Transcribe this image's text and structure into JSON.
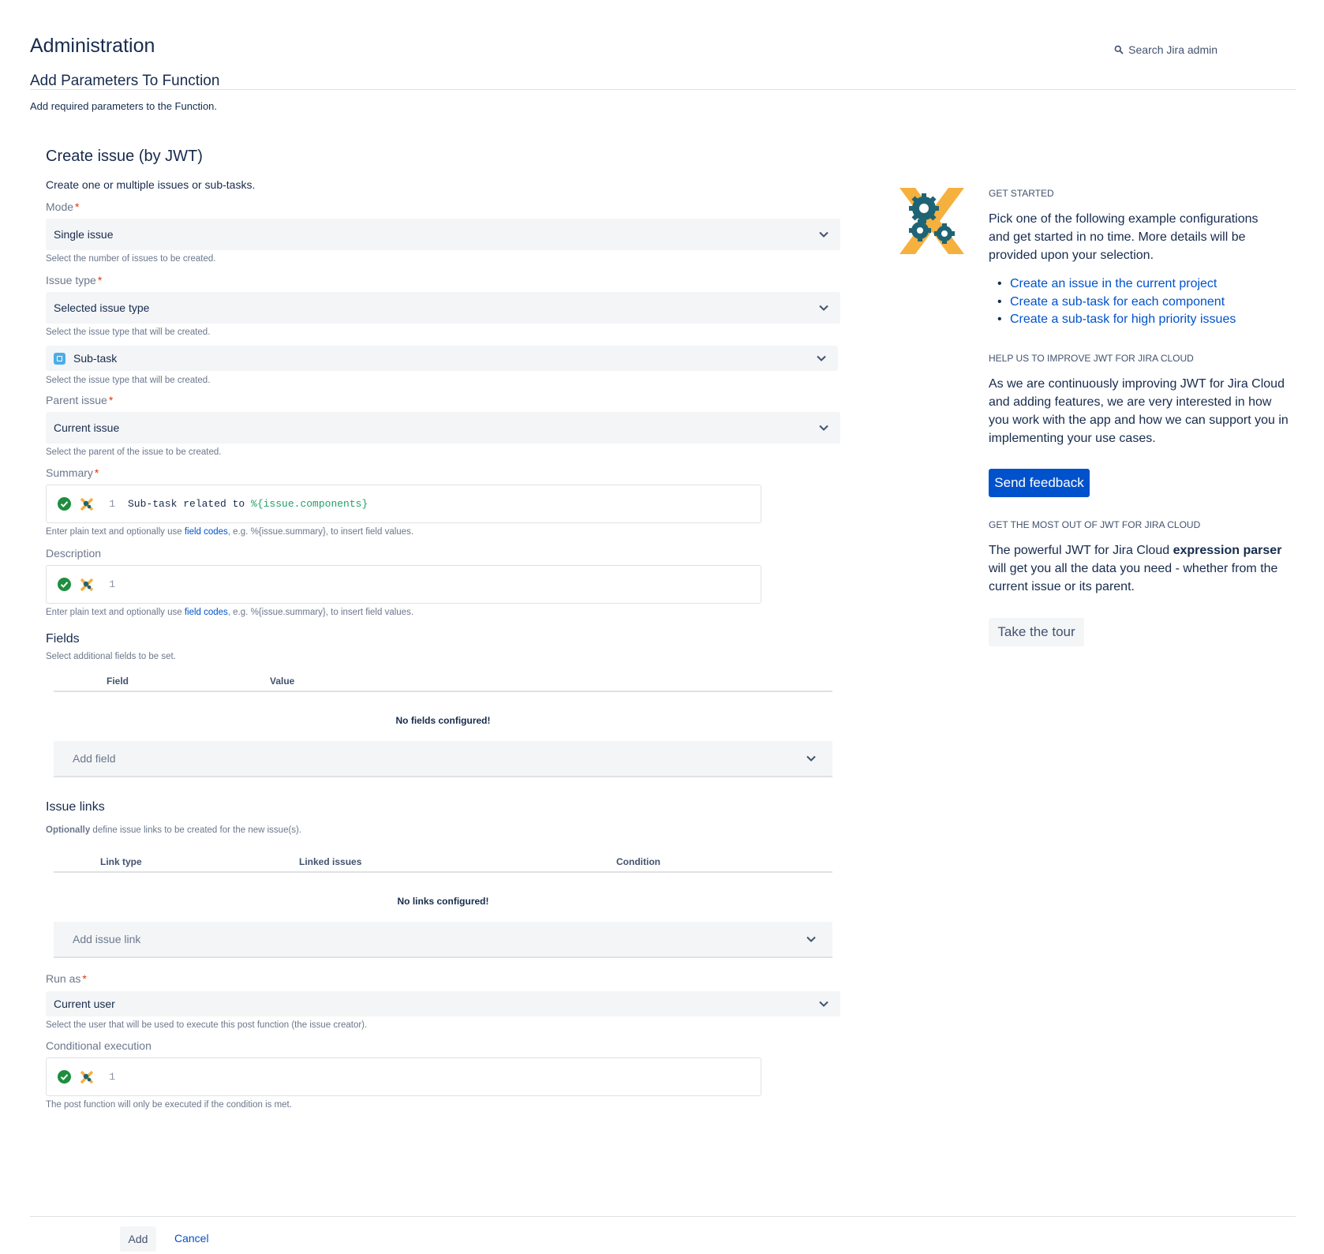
{
  "header": {
    "title": "Administration",
    "search_label": "Search Jira admin",
    "subtitle": "Add Parameters To Function",
    "intro": "Add required parameters to the Function."
  },
  "form": {
    "title": "Create issue (by JWT)",
    "description": "Create one or multiple issues or sub-tasks.",
    "mode": {
      "label": "Mode",
      "value": "Single issue",
      "help": "Select the number of issues to be created."
    },
    "issue_type": {
      "label": "Issue type",
      "value": "Selected issue type",
      "help": "Select the issue type that will be created."
    },
    "issue_type_select": {
      "value": "Sub-task",
      "help": "Select the issue type that will be created."
    },
    "parent_issue": {
      "label": "Parent issue",
      "value": "Current issue",
      "help": "Select the parent of the issue to be created."
    },
    "summary": {
      "label": "Summary",
      "line_no": "1",
      "code_text": "Sub-task related to ",
      "code_field": "%{issue.components}",
      "help_prefix": "Enter plain text and optionally use ",
      "help_link": "field codes",
      "help_suffix": ", e.g. %{issue.summary}, to insert field values."
    },
    "description_field": {
      "label": "Description",
      "line_no": "1",
      "help_prefix": "Enter plain text and optionally use ",
      "help_link": "field codes",
      "help_suffix": ", e.g. %{issue.summary}, to insert field values."
    },
    "fields": {
      "title": "Fields",
      "help": "Select additional fields to be set.",
      "col_field": "Field",
      "col_value": "Value",
      "empty": "No fields configured!",
      "add_placeholder": "Add field"
    },
    "issue_links": {
      "title": "Issue links",
      "help_bold": "Optionally",
      "help_rest": " define issue links to be created for the new issue(s).",
      "col_link_type": "Link type",
      "col_linked_issues": "Linked issues",
      "col_condition": "Condition",
      "empty": "No links configured!",
      "add_placeholder": "Add issue link"
    },
    "run_as": {
      "label": "Run as",
      "value": "Current user",
      "help": "Select the user that will be used to execute this post function (the issue creator)."
    },
    "conditional": {
      "label": "Conditional execution",
      "line_no": "1",
      "help": "The post function will only be executed if the condition is met."
    }
  },
  "sidebar": {
    "get_started_heading": "GET STARTED",
    "get_started_text": "Pick one of the following example configurations and get started in no time. More details will be provided upon your selection.",
    "examples": [
      "Create an issue in the current project",
      "Create a sub-task for each component",
      "Create a sub-task for high priority issues"
    ],
    "improve_heading": "HELP US TO IMPROVE JWT FOR JIRA CLOUD",
    "improve_text": "As we are continuously improving JWT for Jira Cloud and adding features, we are very interested in how you work with the app and how we can support you in implementing your use cases.",
    "feedback_button": "Send feedback",
    "most_heading": "GET THE MOST OUT OF JWT FOR JIRA CLOUD",
    "most_text_prefix": "The powerful JWT for Jira Cloud ",
    "most_text_bold": "expression parser",
    "most_text_suffix": " will get you all the data you need - whether from the current issue or its parent.",
    "tour_button": "Take the tour"
  },
  "footer": {
    "add_label": "Add",
    "cancel_label": "Cancel"
  },
  "colors": {
    "primary": "#0052cc",
    "logo_yellow": "#f6b03e",
    "logo_teal": "#1f6475",
    "success": "#1e8e3e",
    "required": "#de350b"
  },
  "icons": [
    "search-icon",
    "chevron-down-icon",
    "subtask-icon",
    "check-circle-icon",
    "jwt-logo-icon"
  ]
}
